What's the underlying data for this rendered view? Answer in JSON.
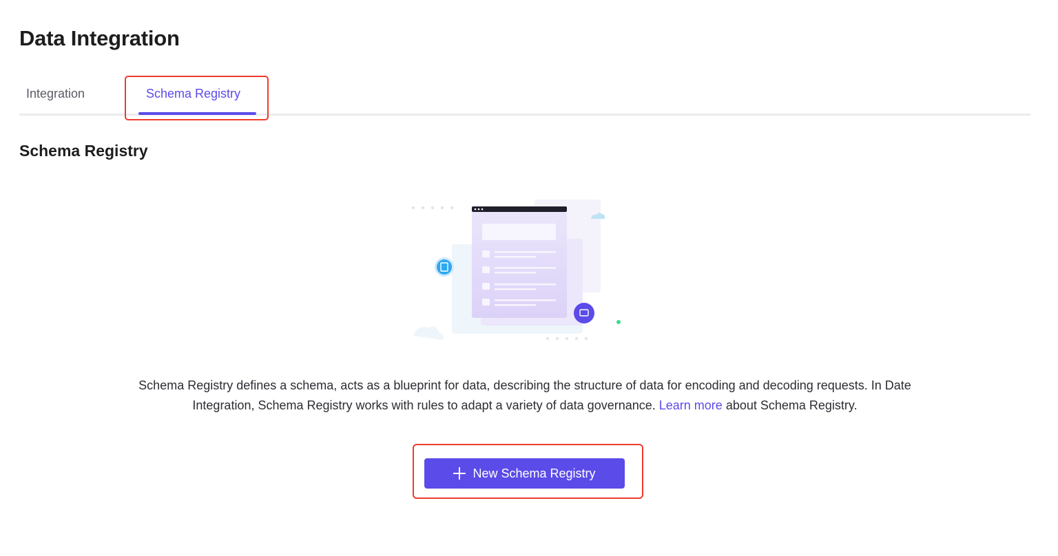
{
  "page": {
    "title": "Data Integration"
  },
  "tabs": [
    {
      "label": "Integration",
      "active": false
    },
    {
      "label": "Schema Registry",
      "active": true
    }
  ],
  "section": {
    "title": "Schema Registry"
  },
  "empty_state": {
    "text_before_link": "Schema Registry defines a schema, acts as a blueprint for data, describing the structure of data for encoding and decoding requests. In Date Integration, Schema Registry works with rules to adapt a variety of data governance. ",
    "link_text": "Learn more",
    "text_after_link": " about Schema Registry.",
    "illustration": "schema-document-illustration"
  },
  "actions": {
    "new_button_label": "New Schema Registry",
    "new_button_icon": "plus-icon"
  },
  "colors": {
    "accent": "#5b4be8",
    "highlight": "#ee3b2b",
    "text": "#1d1d1f"
  }
}
